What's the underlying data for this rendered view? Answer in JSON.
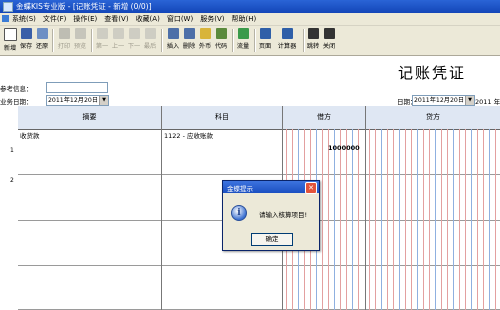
{
  "titlebar": {
    "text": "金蝶KIS专业版 - [记账凭证 - 新增 (0/0)]"
  },
  "menu": [
    "系统(S)",
    "文件(F)",
    "操作(E)",
    "查看(V)",
    "收藏(A)",
    "窗口(W)",
    "服务(V)",
    "帮助(H)"
  ],
  "toolbar": {
    "new": "新增",
    "save": "保存",
    "restore": "还原",
    "print": "打印",
    "preview": "预览",
    "first": "第一",
    "prev": "上一",
    "next": "下一",
    "last": "最后",
    "insert": "插入",
    "delete": "删除",
    "currency": "外币",
    "code": "代码",
    "flow": "流量",
    "page": "页面",
    "calculator": "计算器",
    "jump": "跳转",
    "close": "关闭"
  },
  "voucher": {
    "title": "记账凭证",
    "ref_label": "参考信息：",
    "biz_date_label": "业务日期：",
    "biz_date": "2011年12月20日",
    "date_label": "日期：",
    "date": "2011年12月20日",
    "period": "2011 年"
  },
  "grid": {
    "headers": {
      "summary": "摘要",
      "account": "科目",
      "debit": "借方",
      "credit": "贷方"
    },
    "rows": [
      {
        "num": "1",
        "summary": "收货款",
        "account": "1122 - 应收账款",
        "debit": "1000000"
      },
      {
        "num": "2",
        "summary": "",
        "account": "",
        "debit": ""
      }
    ]
  },
  "dialog": {
    "title": "金蝶提示",
    "message": "请输入核算项目!",
    "ok": "确定"
  },
  "colors": {
    "titlebar": "#1346b8",
    "chrome": "#ece9d8",
    "header_bg": "#dfe7f3",
    "amount_red": "#e3a0a0"
  }
}
